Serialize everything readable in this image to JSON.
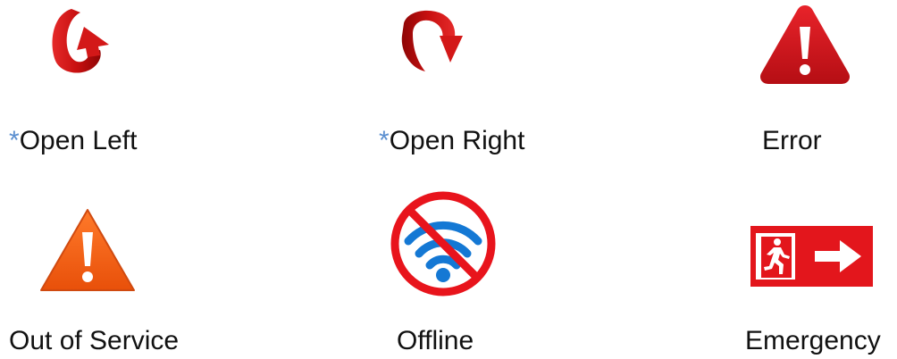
{
  "items": [
    {
      "label": "Open Left",
      "prefix": "*",
      "icon": "open-left-arrow-icon",
      "color": "#cc1414"
    },
    {
      "label": "Open Right",
      "prefix": "*",
      "icon": "open-right-arrow-icon",
      "color": "#cc1414"
    },
    {
      "label": "Error",
      "prefix": "",
      "icon": "error-warning-icon",
      "color": "#d0161e"
    },
    {
      "label": "Out of Service",
      "prefix": "",
      "icon": "warning-icon",
      "color": "#f25c0f"
    },
    {
      "label": "Offline",
      "prefix": "",
      "icon": "no-wifi-icon",
      "color": "#e8141c"
    },
    {
      "label": "Emergency",
      "prefix": "",
      "icon": "emergency-exit-icon",
      "color": "#e3161c"
    }
  ],
  "colors": {
    "star": "#5b8fd0",
    "text": "#111111",
    "wifi_blue": "#1478d4"
  }
}
